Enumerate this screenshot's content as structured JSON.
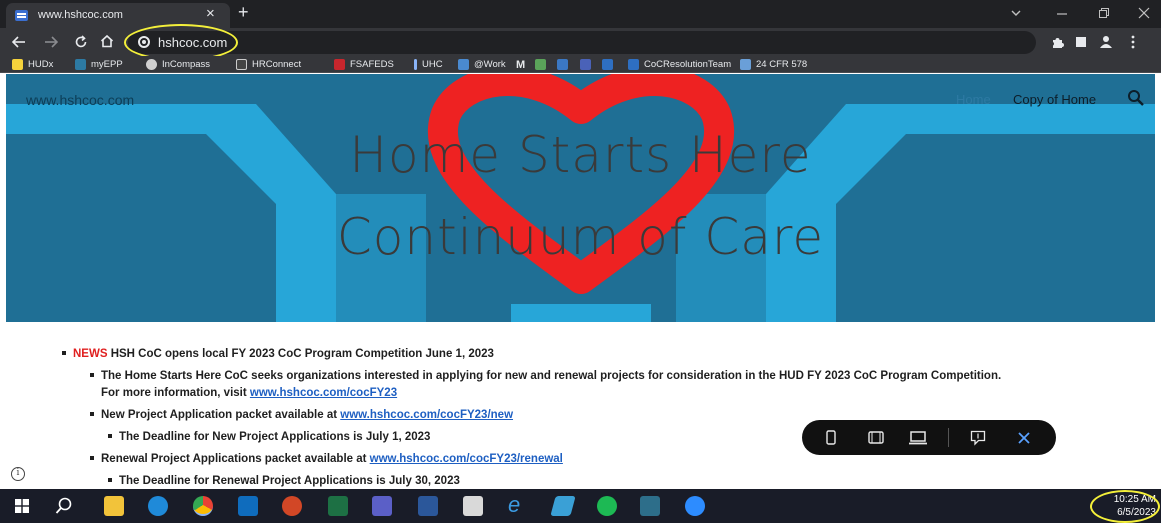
{
  "browser": {
    "tab_title": "www.hshcoc.com",
    "tab_close_glyph": "×",
    "new_tab_glyph": "+",
    "url": "hshcoc.com",
    "bookmarks": [
      "HUDx",
      "myEPP",
      "InCompass",
      "HRConnect",
      "FSAFEDS",
      "UHC",
      "@Work",
      "M",
      "CoCResolutionTeam",
      "24 CFR 578"
    ],
    "highlight_color": "#f4f03a"
  },
  "site": {
    "brand": "www.hshcoc.com",
    "nav": [
      "Home",
      "Copy of Home"
    ],
    "hero_title_line1": "Home Starts Here",
    "hero_title_line2": "Continuum of Care"
  },
  "news": {
    "tag": "NEWS",
    "headline": "HSH CoC opens local FY 2023 CoC Program Competition June 1, 2023",
    "sub1_line1": "The Home Starts Here CoC seeks organizations interested in applying for new and renewal projects for consideration in the HUD FY 2023 CoC Program Competition.",
    "sub1_line2_text": "For more information, visit",
    "sub1_link": "www.hshcoc.com/cocFY23",
    "sub2_text": "New Project Application packet available at",
    "sub2_link": "www.hshcoc.com/cocFY23/new",
    "sub2_deadline": "The Deadline for New Project Applications is July 1, 2023",
    "sub3_text": "Renewal Project Applications packet available at",
    "sub3_link": "www.hshcoc.com/cocFY23/renewal",
    "sub3_deadline": "The Deadline for Renewal Project Applications is July 30, 2023"
  },
  "info_glyph": "i",
  "taskbar": {
    "time": "10:25 AM",
    "date": "6/5/2023"
  },
  "colors": {
    "hero_bg": "#1f6f95",
    "hero_shape": "#27a6d8",
    "heart": "#ee2222",
    "news_red": "#e02020",
    "link_blue": "#1e5fc2"
  }
}
